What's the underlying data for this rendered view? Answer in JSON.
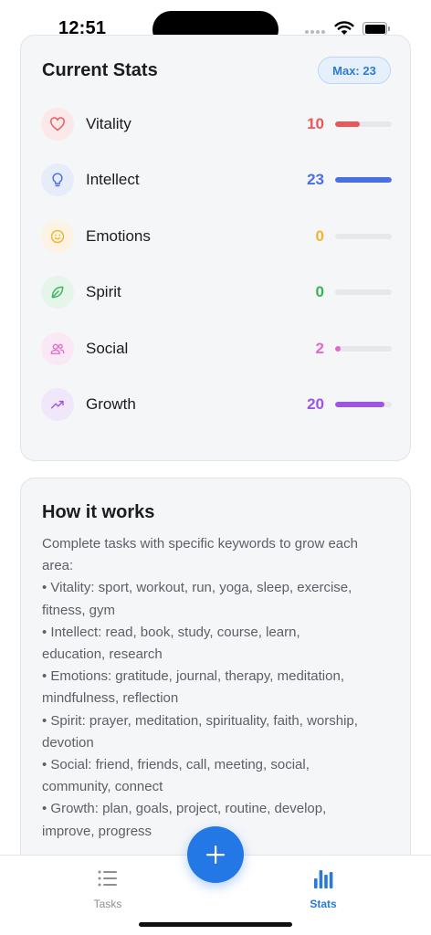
{
  "status_bar": {
    "time": "12:51"
  },
  "stats_card": {
    "title": "Current Stats",
    "max_badge": "Max: 23",
    "max_value": 23,
    "stats": [
      {
        "name": "Vitality",
        "value": "10",
        "progress": 0.43,
        "icon": "heart-icon",
        "color": "#e8585a",
        "tint": "#fbe9ea"
      },
      {
        "name": "Intellect",
        "value": "23",
        "progress": 1.0,
        "icon": "lightbulb-icon",
        "color": "#4a6fe3",
        "tint": "#e7ecfb"
      },
      {
        "name": "Emotions",
        "value": "0",
        "progress": 0.0,
        "icon": "smiley-icon",
        "color": "#f0b431",
        "tint": "#fdf3e2"
      },
      {
        "name": "Spirit",
        "value": "0",
        "progress": 0.0,
        "icon": "leaf-icon",
        "color": "#39b35a",
        "tint": "#e6f5ea"
      },
      {
        "name": "Social",
        "value": "2",
        "progress": 0.09,
        "icon": "people-icon",
        "color": "#e468c9",
        "tint": "#fbe8f6"
      },
      {
        "name": "Growth",
        "value": "20",
        "progress": 0.87,
        "icon": "trending-up-icon",
        "color": "#9d55e3",
        "tint": "#f1e7fb"
      }
    ]
  },
  "how_card": {
    "title": "How it works",
    "lines": [
      "Complete tasks with specific keywords to grow each",
      "area:",
      "• Vitality: sport, workout, run, yoga, sleep, exercise,",
      "fitness, gym",
      "• Intellect: read, book, study, course, learn,",
      "education, research",
      "• Emotions: gratitude, journal, therapy, meditation,",
      "mindfulness, reflection",
      "• Spirit: prayer, meditation, spirituality, faith, worship,",
      "devotion",
      "• Social: friend, friends, call, meeting, social,",
      "community, connect",
      "• Growth: plan, goals, project, routine, develop,",
      "improve, progress"
    ]
  },
  "tab_bar": {
    "tasks_label": "Tasks",
    "stats_label": "Stats",
    "active_color": "#2a7bd7",
    "inactive_color": "#8e8e93"
  },
  "fab": {
    "icon": "plus-icon",
    "color": "#2478e6"
  }
}
